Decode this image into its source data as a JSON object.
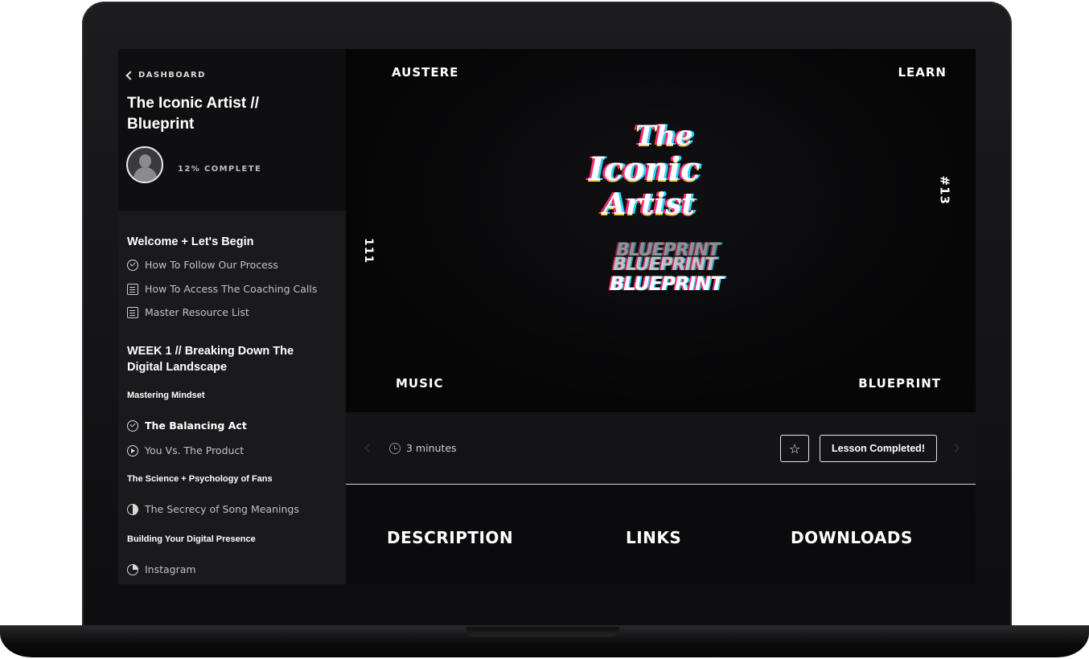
{
  "sidebar": {
    "back_label": "DASHBOARD",
    "course_title": "The Iconic Artist // Blueprint",
    "progress_text": "12% COMPLETE",
    "sections": [
      {
        "title": "Welcome + Let's Begin",
        "lessons": [
          {
            "label": "How To Follow Our Process",
            "icon": "check-circle-icon"
          },
          {
            "label": "How To Access The Coaching Calls",
            "icon": "document-icon"
          },
          {
            "label": "Master Resource List",
            "icon": "document-icon"
          }
        ]
      },
      {
        "title": "WEEK 1 // Breaking Down The Digital Landscape",
        "groups": [
          {
            "title": "Mastering Mindset",
            "lessons": [
              {
                "label": "The Balancing Act",
                "icon": "check-circle-icon",
                "active": true
              },
              {
                "label": "You Vs. The Product",
                "icon": "play-circle-icon"
              }
            ]
          },
          {
            "title": "The Science + Psychology of Fans",
            "lessons": [
              {
                "label": "The Secrecy of Song Meanings",
                "icon": "half-circle-icon"
              }
            ]
          },
          {
            "title": "Building Your Digital Presence",
            "lessons": [
              {
                "label": "Instagram",
                "icon": "quarter-circle-icon"
              }
            ]
          }
        ]
      }
    ]
  },
  "video": {
    "corner_top_left": "AUSTERE",
    "corner_top_right": "LEARN",
    "corner_bottom_left": "MUSIC",
    "corner_bottom_right": "BLUEPRINT",
    "side_left": "111",
    "side_right": "#13",
    "art_lines": [
      "The",
      "Iconic",
      "Artist",
      "BLUEPRINT"
    ]
  },
  "controls": {
    "duration": "3 minutes",
    "favorite_icon": "star-icon",
    "complete_label": "Lesson Completed!"
  },
  "tabs": [
    "DESCRIPTION",
    "LINKS",
    "DOWNLOADS"
  ],
  "colors": {
    "background": "#0b0b0d",
    "sidebar": "#1a1a1d",
    "text": "#ffffff",
    "accent_red": "#ff2a6d",
    "accent_cyan": "#2ad5ff"
  }
}
